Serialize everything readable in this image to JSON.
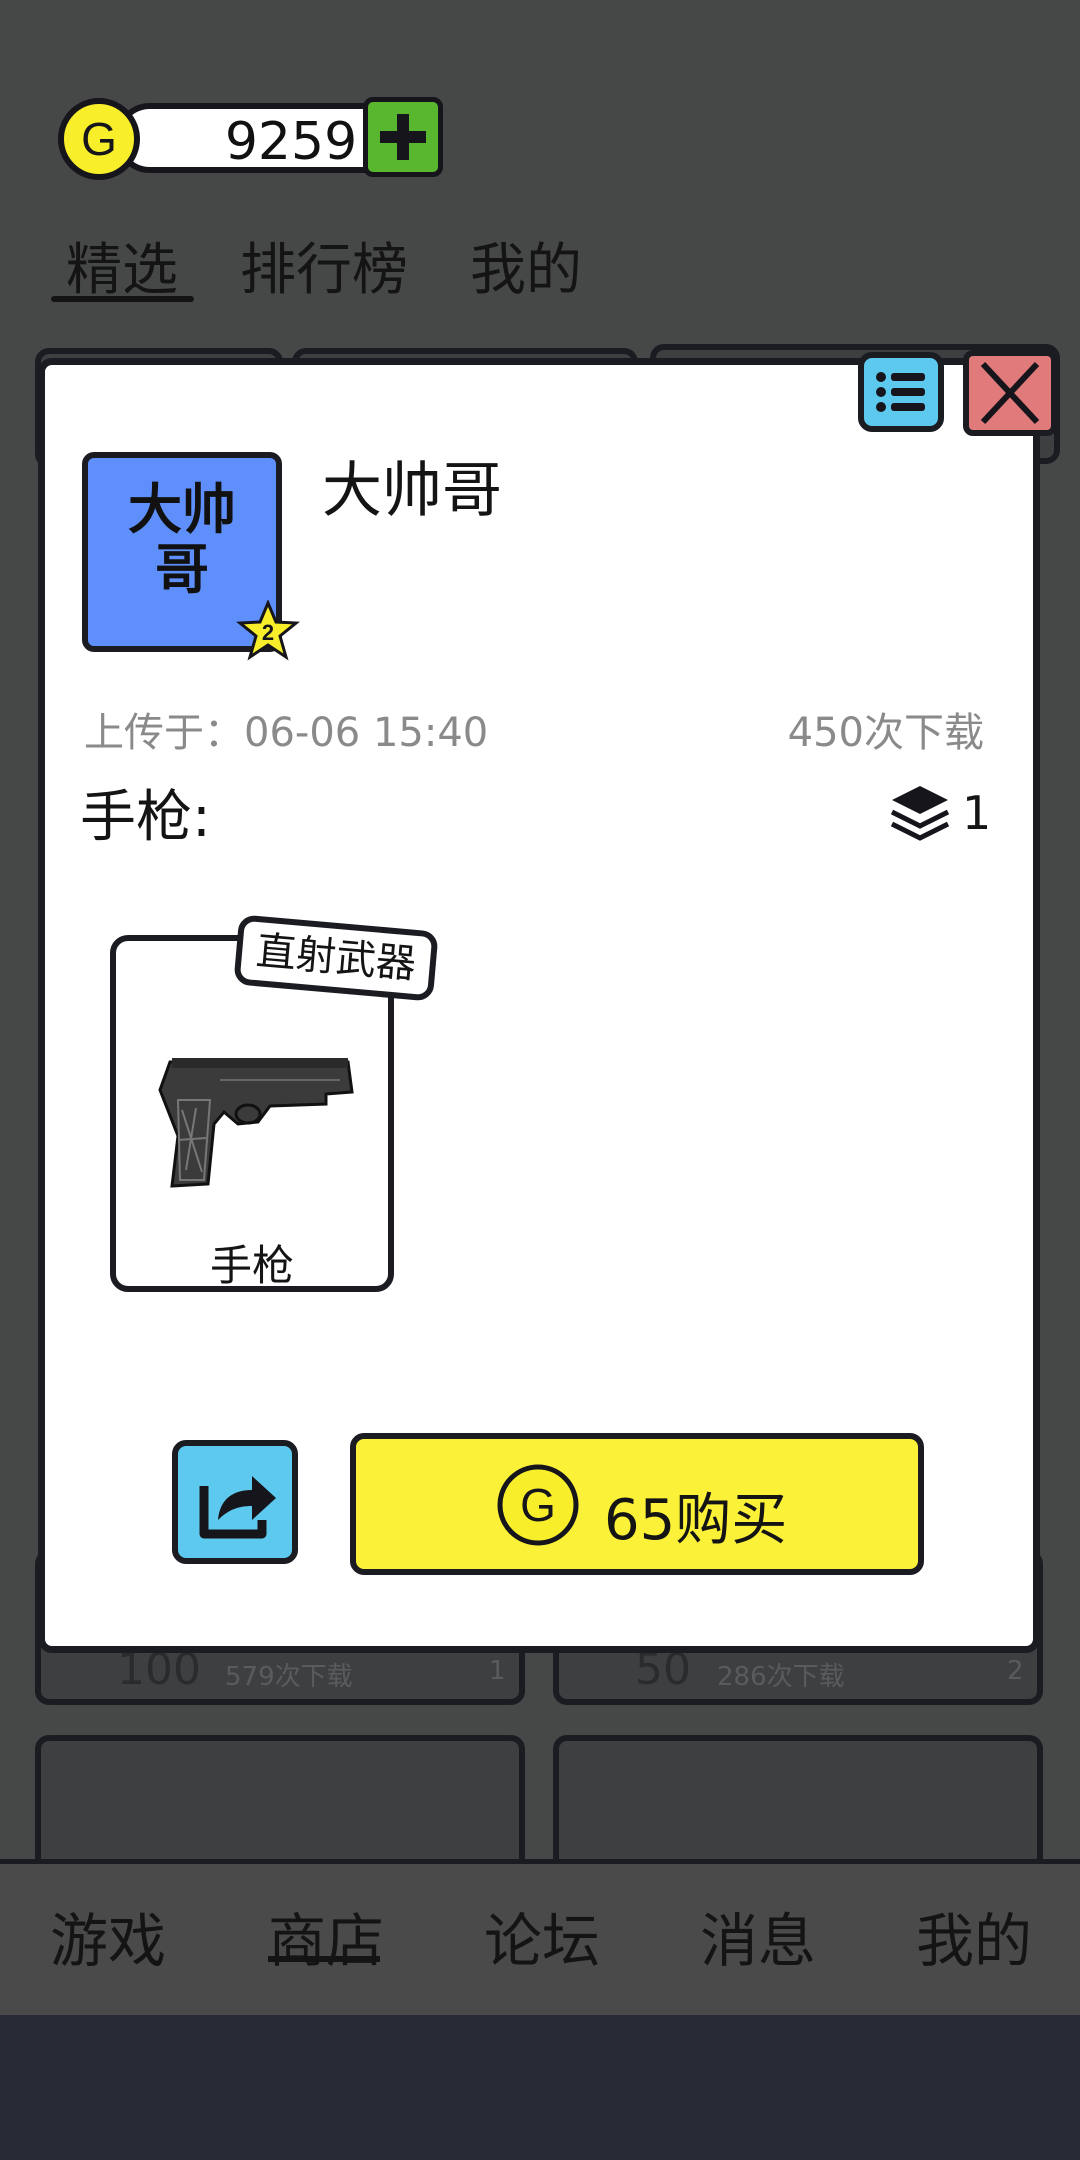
{
  "coins": {
    "value": "9259"
  },
  "top_tabs": [
    {
      "label": "精选"
    },
    {
      "label": "排行榜"
    },
    {
      "label": "我的"
    }
  ],
  "bottom_nav": [
    {
      "label": "游戏"
    },
    {
      "label": "商店"
    },
    {
      "label": "论坛"
    },
    {
      "label": "消息"
    },
    {
      "label": "我的"
    }
  ],
  "background_cards": [
    {
      "price": "100",
      "downloads": "579次下载",
      "layers": "1"
    },
    {
      "price": "50",
      "downloads": "286次下载",
      "layers": "2"
    }
  ],
  "modal": {
    "avatar_text": "大帅哥",
    "avatar_level": "2",
    "author": "大帅哥",
    "upload_time": "上传于：06-06 15:40",
    "downloads": "450次下载",
    "category": "手枪:",
    "layer_count": "1",
    "item": {
      "tag": "直射武器",
      "name": "手枪",
      "icon": "pistol-image"
    },
    "buy_label": "65购买",
    "colors": {
      "buy": "#fbf138",
      "share": "#5ec9ee",
      "close": "#e17a7a",
      "avatar": "#5f8ffb",
      "add": "#58b62f"
    }
  }
}
